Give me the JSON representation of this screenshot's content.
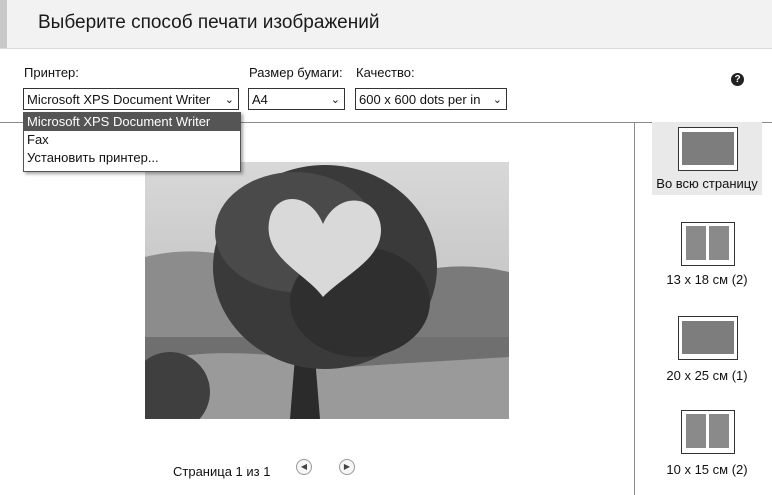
{
  "header": {
    "title": "Выберите способ печати изображений"
  },
  "printer": {
    "label": "Принтер:",
    "value": "Microsoft XPS Document Writer",
    "options": [
      "Microsoft XPS Document Writer",
      "Fax",
      "Установить принтер..."
    ]
  },
  "paper": {
    "label": "Размер бумаги:",
    "value": "A4"
  },
  "quality": {
    "label": "Качество:",
    "value": "600 x 600 dots per in"
  },
  "help": "?",
  "pager": {
    "text": "Страница 1 из 1"
  },
  "layouts": [
    {
      "label": "Во всю страницу"
    },
    {
      "label": "13 x 18 см (2)"
    },
    {
      "label": "20 x 25 см (1)"
    },
    {
      "label": "10 x 15 см (2)"
    }
  ]
}
